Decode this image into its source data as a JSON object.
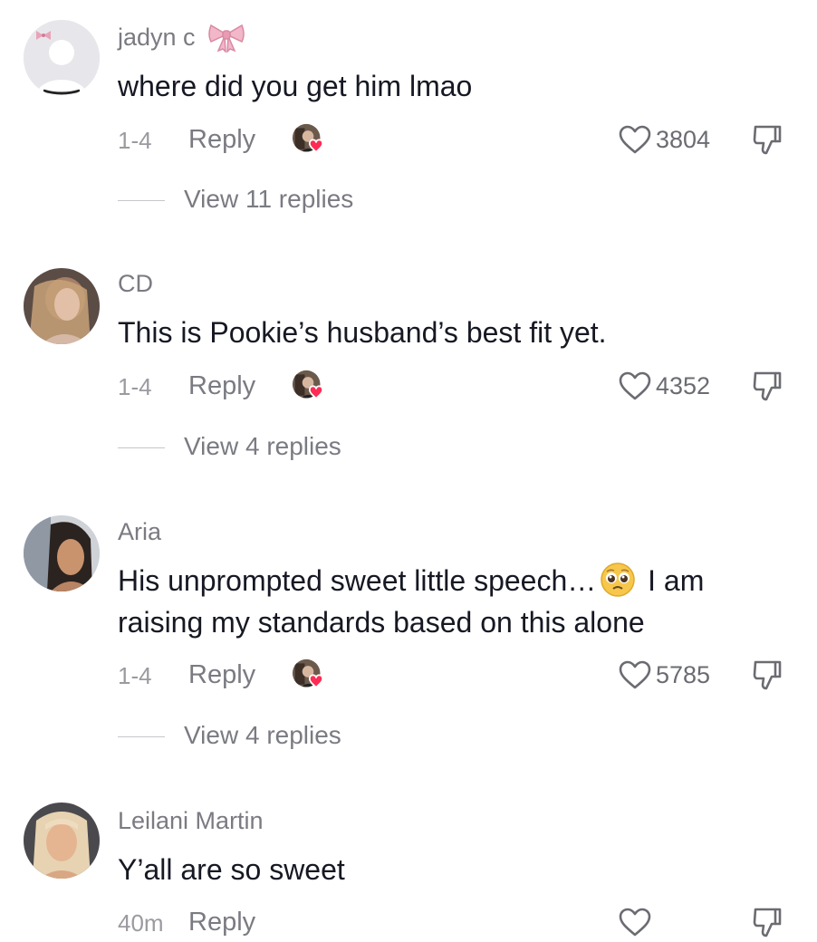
{
  "comments": [
    {
      "username": "jadyn c",
      "username_emoji": "ribbon-emoji",
      "text": "where did you get him lmao",
      "date": "1-4",
      "reply_label": "Reply",
      "likes": "3804",
      "view_replies": "View 11 replies",
      "creator_liked": true
    },
    {
      "username": "CD",
      "text": "This is Pookie’s husband’s best fit yet.",
      "date": "1-4",
      "reply_label": "Reply",
      "likes": "4352",
      "view_replies": "View 4 replies",
      "creator_liked": true
    },
    {
      "username": "Aria",
      "text_before_emoji": "His unprompted sweet little speech…",
      "text_emoji": "pleading-face-emoji",
      "text_after_emoji": " I am raising my standards based on this alone",
      "date": "1-4",
      "reply_label": "Reply",
      "likes": "5785",
      "view_replies": "View 4 replies",
      "creator_liked": true
    },
    {
      "username": "Leilani Martin",
      "text": "Y’all are so sweet",
      "date": "40m",
      "reply_label": "Reply",
      "likes": "",
      "creator_liked": false
    }
  ],
  "icons": {
    "like": "heart-outline-icon",
    "dislike": "thumbs-down-icon",
    "creator": "creator-liked-avatar"
  },
  "colors": {
    "text": "#161823",
    "secondary": "#7a7b82",
    "creator_heart": "#fe2c55"
  }
}
